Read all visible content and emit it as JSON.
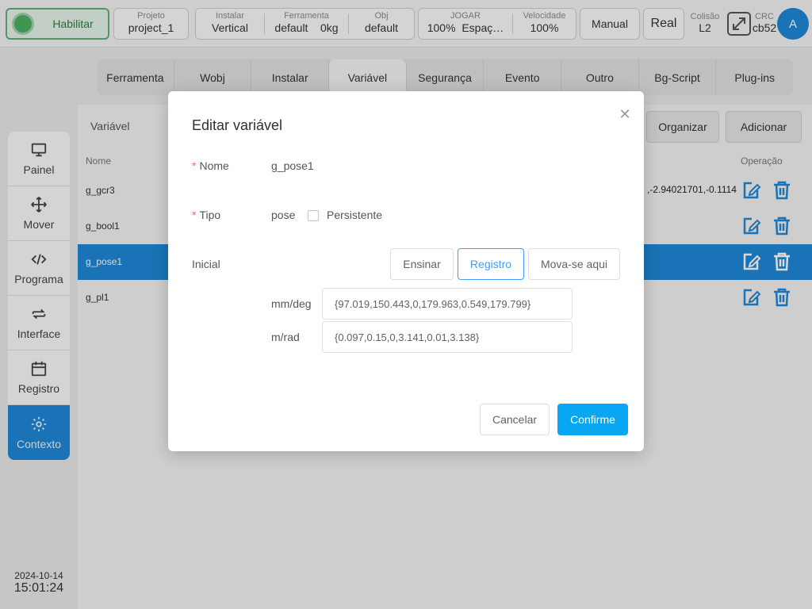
{
  "topbar": {
    "enable_label": "Habilitar",
    "project": {
      "label": "Projeto",
      "value": "project_1"
    },
    "install": {
      "label": "Instalar",
      "value": "Vertical"
    },
    "tool": {
      "label": "Ferramenta",
      "value": "default",
      "weight": "0kg"
    },
    "obj": {
      "label": "Obj",
      "value": "default"
    },
    "jog": {
      "label": "JOGAR",
      "value": "100%",
      "space": "Espaç…"
    },
    "speed": {
      "label": "Velocidade",
      "value": "100%"
    },
    "mode_btn": "Manual",
    "real_btn": "Real",
    "collision": {
      "label": "Colisão",
      "value": "L2"
    },
    "crc": {
      "label": "CRC",
      "value": "cb52"
    },
    "avatar": "A"
  },
  "sidebar": {
    "items": [
      {
        "label": "Painel",
        "icon": "monitor-icon"
      },
      {
        "label": "Mover",
        "icon": "move-arrows-icon"
      },
      {
        "label": "Programa",
        "icon": "code-icon"
      },
      {
        "label": "Interface",
        "icon": "swap-arrows-icon"
      },
      {
        "label": "Registro",
        "icon": "calendar-icon"
      },
      {
        "label": "Contexto",
        "icon": "gear-icon"
      }
    ],
    "date": "2024-10-14",
    "time": "15:01:24"
  },
  "tabs": [
    "Ferramenta",
    "Wobj",
    "Instalar",
    "Variável",
    "Segurança",
    "Evento",
    "Outro",
    "Bg-Script",
    "Plug-ins"
  ],
  "panel": {
    "title": "Variável",
    "organize_btn": "Organizar",
    "add_btn": "Adicionar",
    "col_name": "Nome",
    "col_op": "Operação",
    "rows": [
      {
        "name": "g_gcr3",
        "extra": ",-2.94021701,-0.1114"
      },
      {
        "name": "g_bool1",
        "extra": ""
      },
      {
        "name": "g_pose1",
        "extra": ""
      },
      {
        "name": "g_pl1",
        "extra": ""
      }
    ]
  },
  "modal": {
    "title": "Editar variável",
    "name_label": "Nome",
    "name_value": "g_pose1",
    "type_label": "Tipo",
    "type_value": "pose",
    "persistent_label": "Persistente",
    "initial_label": "Inicial",
    "teach_btn": "Ensinar",
    "record_btn": "Registro",
    "move_btn": "Mova-se aqui",
    "mmdeg_label": "mm/deg",
    "mmdeg_value": "{97.019,150.443,0,179.963,0.549,179.799}",
    "mrad_label": "m/rad",
    "mrad_value": "{0.097,0.15,0,3.141,0.01,3.138}",
    "cancel_btn": "Cancelar",
    "confirm_btn": "Confirme"
  },
  "colors": {
    "accent": "#1e88d6",
    "primary_btn": "#09a6f3",
    "enable_green": "#4caf62"
  }
}
